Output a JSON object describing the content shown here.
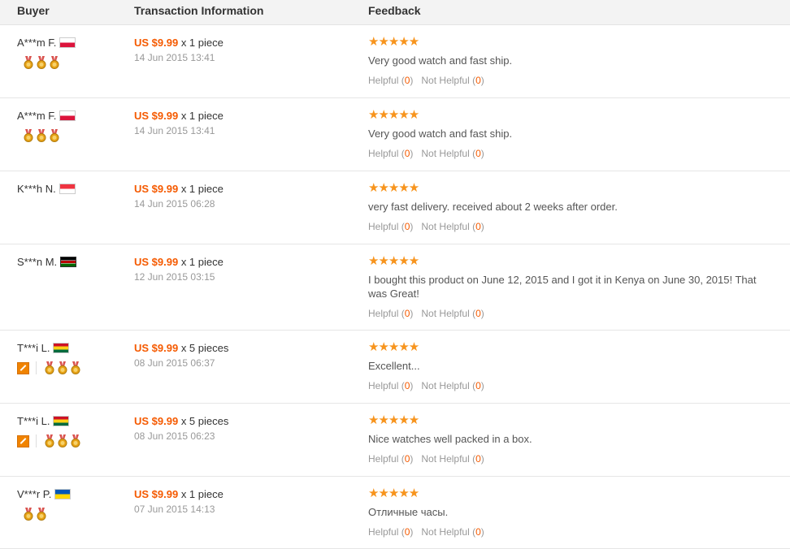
{
  "header": {
    "buyer": "Buyer",
    "transaction": "Transaction Information",
    "feedback": "Feedback"
  },
  "colors": {
    "price": "#f55a00",
    "stars": "#f7941d",
    "medal": "#e8a317"
  },
  "reviews": [
    {
      "buyer": "A***m F.",
      "flag": "poland",
      "medals": 3,
      "award_icon": false,
      "price": "US $9.99",
      "qty": " x 1 piece",
      "date": "14 Jun 2015 13:41",
      "stars": "★★★★★",
      "text": "Very good watch and fast ship.",
      "helpful_label": "Helpful",
      "helpful_count": "0",
      "not_helpful_label": "Not Helpful",
      "not_helpful_count": "0"
    },
    {
      "buyer": "A***m F.",
      "flag": "poland",
      "medals": 3,
      "award_icon": false,
      "price": "US $9.99",
      "qty": " x 1 piece",
      "date": "14 Jun 2015 13:41",
      "stars": "★★★★★",
      "text": "Very good watch and fast ship.",
      "helpful_label": "Helpful",
      "helpful_count": "0",
      "not_helpful_label": "Not Helpful",
      "not_helpful_count": "0"
    },
    {
      "buyer": "K***h N.",
      "flag": "singapore",
      "medals": 0,
      "award_icon": false,
      "price": "US $9.99",
      "qty": " x 1 piece",
      "date": "14 Jun 2015 06:28",
      "stars": "★★★★★",
      "text": "very fast delivery. received about 2 weeks after order.",
      "helpful_label": "Helpful",
      "helpful_count": "0",
      "not_helpful_label": "Not Helpful",
      "not_helpful_count": "0"
    },
    {
      "buyer": "S***n M.",
      "flag": "kenya",
      "medals": 0,
      "award_icon": false,
      "price": "US $9.99",
      "qty": " x 1 piece",
      "date": "12 Jun 2015 03:15",
      "stars": "★★★★★",
      "text": "I bought this product on June 12, 2015 and I got it in Kenya on June 30, 2015! That was Great!",
      "helpful_label": "Helpful",
      "helpful_count": "0",
      "not_helpful_label": "Not Helpful",
      "not_helpful_count": "0"
    },
    {
      "buyer": "T***i L.",
      "flag": "ghana",
      "medals": 3,
      "award_icon": true,
      "price": "US $9.99",
      "qty": " x 5 pieces",
      "date": "08 Jun 2015 06:37",
      "stars": "★★★★★",
      "text": "Excellent...",
      "helpful_label": "Helpful",
      "helpful_count": "0",
      "not_helpful_label": "Not Helpful",
      "not_helpful_count": "0"
    },
    {
      "buyer": "T***i L.",
      "flag": "ghana",
      "medals": 3,
      "award_icon": true,
      "price": "US $9.99",
      "qty": " x 5 pieces",
      "date": "08 Jun 2015 06:23",
      "stars": "★★★★★",
      "text": "Nice watches well packed in a box.",
      "helpful_label": "Helpful",
      "helpful_count": "0",
      "not_helpful_label": "Not Helpful",
      "not_helpful_count": "0"
    },
    {
      "buyer": "V***r P.",
      "flag": "ukraine",
      "medals": 2,
      "award_icon": false,
      "price": "US $9.99",
      "qty": " x 1 piece",
      "date": "07 Jun 2015 14:13",
      "stars": "★★★★★",
      "text": "Отличные часы.",
      "helpful_label": "Helpful",
      "helpful_count": "0",
      "not_helpful_label": "Not Helpful",
      "not_helpful_count": "0"
    }
  ]
}
